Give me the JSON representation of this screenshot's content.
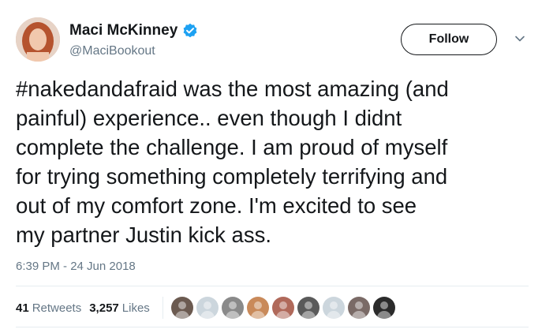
{
  "author": {
    "display_name": "Maci McKinney",
    "handle": "@MaciBookout",
    "verified": true
  },
  "actions": {
    "follow_label": "Follow",
    "menu_icon": "chevron-down-icon"
  },
  "tweet": {
    "text": "#nakedandafraid was the most amazing (and\npainful) experience.. even though I didnt\ncomplete the challenge. I am proud of myself\nfor trying something completely terrifying and\nout of my comfort zone. I'm excited to see\nmy partner Justin kick ass.",
    "timestamp": "6:39 PM - 24 Jun 2018"
  },
  "stats": {
    "retweets_count": "41",
    "retweets_label": "Retweets",
    "likes_count": "3,257",
    "likes_label": "Likes"
  },
  "liker_avatars": [
    {
      "name": "liker-avatar-1",
      "color": "#6b5a50"
    },
    {
      "name": "liker-avatar-2",
      "color": "#ccd6dd"
    },
    {
      "name": "liker-avatar-3",
      "color": "#8a8a8a"
    },
    {
      "name": "liker-avatar-4",
      "color": "#c98a5a"
    },
    {
      "name": "liker-avatar-5",
      "color": "#b0695a"
    },
    {
      "name": "liker-avatar-6",
      "color": "#5a5a5a"
    },
    {
      "name": "liker-avatar-7",
      "color": "#ccd6dd"
    },
    {
      "name": "liker-avatar-8",
      "color": "#7a6a66"
    },
    {
      "name": "liker-avatar-9",
      "color": "#2b2b2b"
    }
  ],
  "colors": {
    "text": "#14171a",
    "secondary": "#657786",
    "verified_blue": "#1da1f2",
    "divider": "#e6ecf0"
  }
}
